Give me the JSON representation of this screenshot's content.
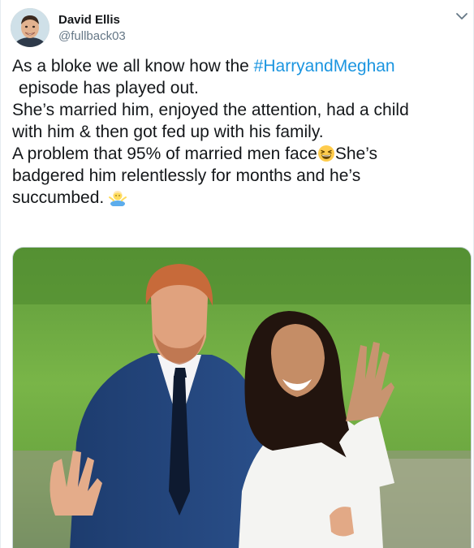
{
  "tweet": {
    "author_name": "David Ellis",
    "author_handle": "@fullback03",
    "avatar_icon": "user-avatar",
    "menu_icon": "chevron-down-icon",
    "text": {
      "line1_prefix": "As a bloke we all know how the ",
      "hashtag": "#HarryandMeghan",
      "line2": "episode has played out.",
      "line3": "She’s married him, enjoyed the attention, had a child",
      "line4": "with him & then got fed up with his family.",
      "line5_prefix": "A problem that 95% of married men face",
      "line5_suffix": "She’s",
      "line6": "badgered him relentlessly for months and he’s",
      "line7": "succumbed."
    },
    "emoji_laughing": "grinning-squinting-face-emoji",
    "emoji_shrug": "man-shrugging-emoji",
    "media_image": "photo-couple-waving",
    "colors": {
      "hashtag": "#1b95e0",
      "handle": "#657786",
      "text": "#14171a"
    }
  }
}
